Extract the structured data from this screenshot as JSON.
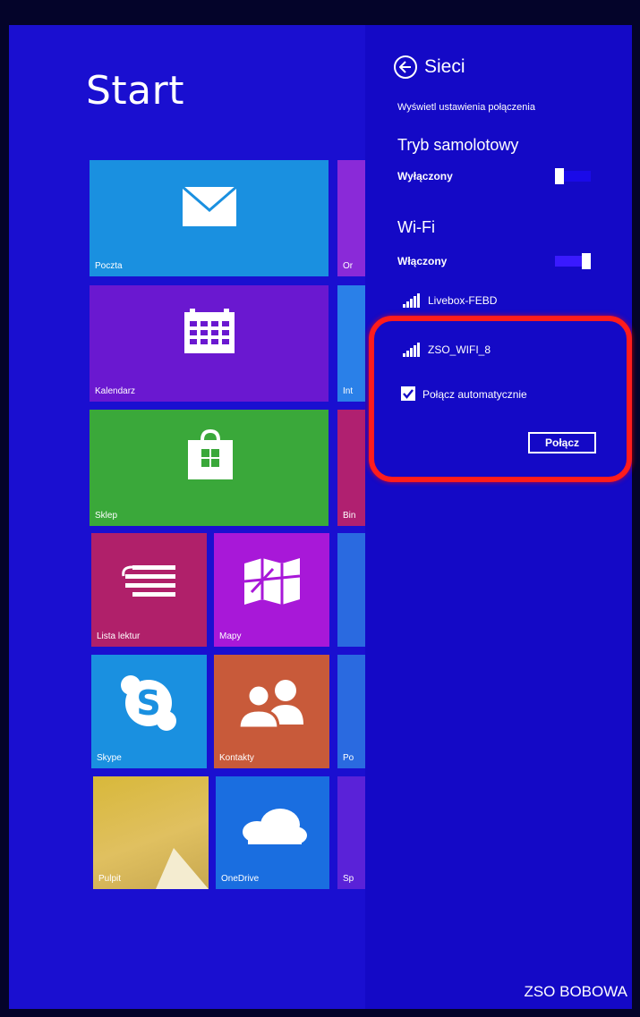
{
  "start": {
    "title": "Start"
  },
  "tiles": {
    "mail": "Poczta",
    "calendar": "Kalendarz",
    "store": "Sklep",
    "reading_list": "Lista lektur",
    "maps": "Mapy",
    "skype": "Skype",
    "contacts": "Kontakty",
    "desktop": "Pulpit",
    "onedrive": "OneDrive",
    "partial_1": "Or",
    "partial_2": "Int",
    "partial_3": "Bin",
    "partial_4": "Po",
    "partial_5": "Sp"
  },
  "charms": {
    "title": "Sieci",
    "view_settings": "Wyświetl ustawienia połączenia",
    "airplane": {
      "heading": "Tryb samolotowy",
      "state": "Wyłączony",
      "on": false
    },
    "wifi": {
      "heading": "Wi-Fi",
      "state": "Włączony",
      "on": true
    },
    "networks": [
      {
        "name": "Livebox-FEBD"
      },
      {
        "name": "ZSO_WIFI_8",
        "connect_auto_label": "Połącz automatycznie",
        "connect_auto_checked": true,
        "connect_label": "Połącz"
      }
    ]
  },
  "watermark": "ZSO BOBOWA",
  "colors": {
    "start_bg": "#1a0fd0",
    "charms_bg": "#1409c6",
    "highlight": "#ff1c1c",
    "tile_mail": "#1a90e0",
    "tile_calendar": "#6a18d0",
    "tile_store": "#3aa83a",
    "tile_reading": "#b0206a",
    "tile_maps": "#a818d8",
    "tile_skype": "#1a90e0",
    "tile_contacts": "#c85a3a",
    "tile_desktop": "#d8b83a",
    "tile_onedrive": "#1a6ee0"
  }
}
